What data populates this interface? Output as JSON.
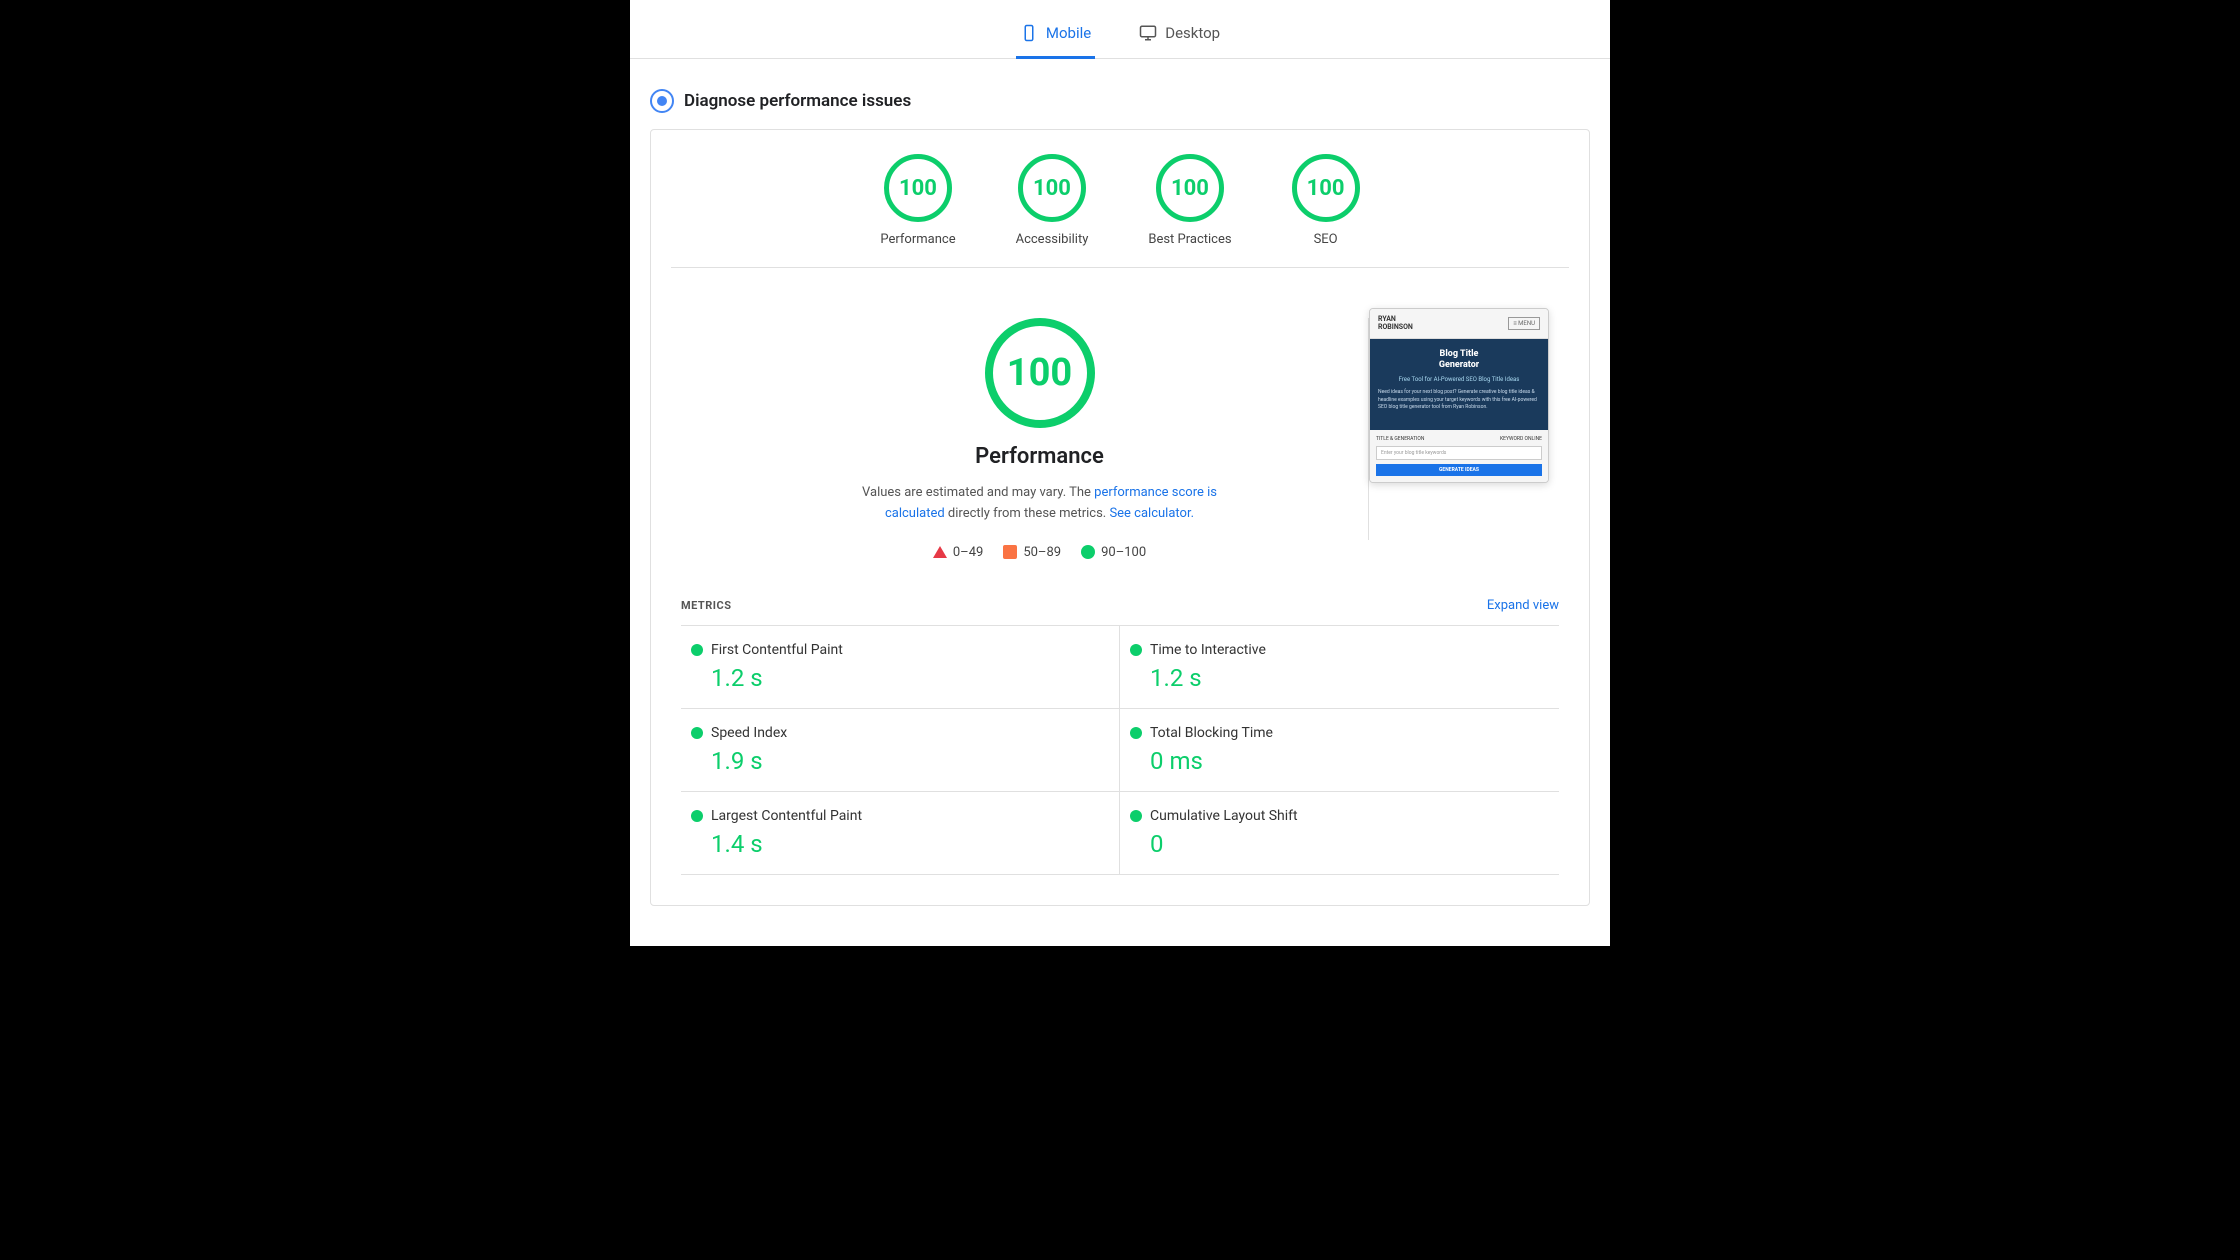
{
  "tabs": [
    {
      "id": "mobile",
      "label": "Mobile",
      "active": true
    },
    {
      "id": "desktop",
      "label": "Desktop",
      "active": false
    }
  ],
  "diagnose": {
    "title": "Diagnose performance issues"
  },
  "scoreCircles": [
    {
      "id": "performance",
      "score": "100",
      "label": "Performance"
    },
    {
      "id": "accessibility",
      "score": "100",
      "label": "Accessibility"
    },
    {
      "id": "best-practices",
      "score": "100",
      "label": "Best Practices"
    },
    {
      "id": "seo",
      "score": "100",
      "label": "SEO"
    }
  ],
  "mainScore": {
    "score": "100",
    "title": "Performance",
    "desc_before": "Values are estimated and may vary. The ",
    "desc_link": "performance score is calculated",
    "desc_after": " directly from these metrics. ",
    "desc_link2": "See calculator.",
    "legend": [
      {
        "type": "red",
        "range": "0–49"
      },
      {
        "type": "orange",
        "range": "50–89"
      },
      {
        "type": "green",
        "range": "90–100"
      }
    ]
  },
  "screenshot": {
    "logo_line1": "RYAN",
    "logo_line2": "ROBINSON",
    "menu": "≡ MENU",
    "title_line1": "Blog Title",
    "title_line2": "Generator",
    "subtitle": "Free Tool for AI-Powered SEO Blog Title Ideas",
    "body_text": "Need ideas for your next blog post? Generate creative blog title ideas & headline examples using your target keywords with this free AI-powered SEO blog title generator tool from Ryan Robinson.",
    "form_label1": "TITLE & GENERATION",
    "form_label2": "KEYWORD ONLINE",
    "input_placeholder": "Enter your blog title keywords",
    "button_label": "GENERATE IDEAS"
  },
  "metrics": {
    "title": "METRICS",
    "expand_label": "Expand view",
    "items": [
      {
        "name": "First Contentful Paint",
        "value": "1.2 s"
      },
      {
        "name": "Time to Interactive",
        "value": "1.2 s"
      },
      {
        "name": "Speed Index",
        "value": "1.9 s"
      },
      {
        "name": "Total Blocking Time",
        "value": "0 ms"
      },
      {
        "name": "Largest Contentful Paint",
        "value": "1.4 s"
      },
      {
        "name": "Cumulative Layout Shift",
        "value": "0"
      }
    ]
  }
}
